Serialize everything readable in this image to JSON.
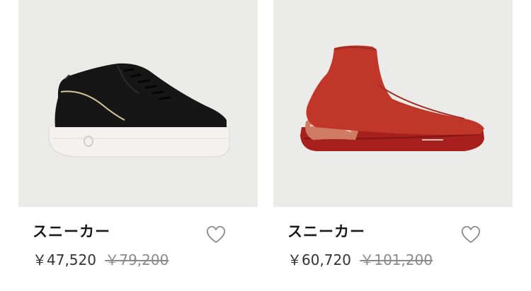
{
  "products": [
    {
      "name": "スニーカー",
      "price": "￥47,520",
      "original_price": "￥79,200",
      "image": "black-leather-sneaker",
      "wishlist_icon": "heart-outline-icon"
    },
    {
      "name": "スニーカー",
      "price": "￥60,720",
      "original_price": "￥101,200",
      "image": "red-knit-sock-sneaker",
      "wishlist_icon": "heart-outline-icon"
    }
  ],
  "colors": {
    "image_bg": "#ebebe9",
    "text": "#1a1a1a",
    "strike": "#8a8a8a"
  }
}
